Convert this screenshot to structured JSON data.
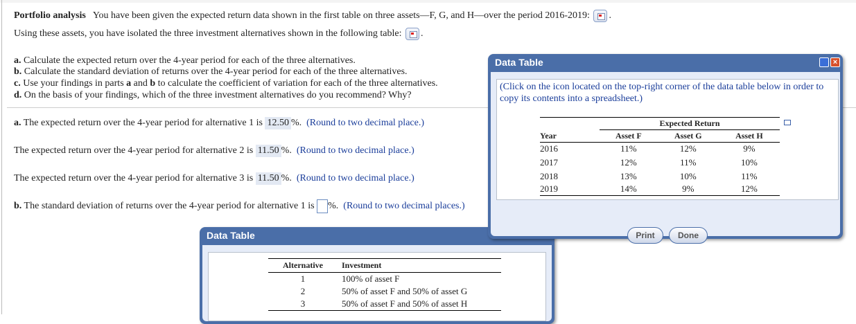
{
  "problem": {
    "title": "Portfolio analysis",
    "intro1": "You have been given the expected return data shown in the first table on three assets—F, G, and H—over the period 2016-2019:",
    "intro2": "Using these assets, you have isolated the three investment alternatives shown in the following table:",
    "parts": [
      {
        "letter": "a.",
        "text": "Calculate the expected return over the 4-year period for each of the three alternatives."
      },
      {
        "letter": "b.",
        "text": "Calculate the standard deviation of returns over the 4-year period for each of the three alternatives."
      },
      {
        "letter": "c.",
        "pre": "Use your findings in parts",
        "a": "a",
        "and": "and",
        "b": "b",
        "post": "to calculate the coefficient of variation for each of the three alternatives."
      },
      {
        "letter": "d.",
        "text": "On the basis of your findings, which of the three investment alternatives do you recommend?  Why?"
      }
    ]
  },
  "answers": [
    {
      "letter": "a.",
      "pre": "The expected return over the 4-year period for alternative 1 is",
      "value": "12.50",
      "unit": "%.",
      "hint": "(Round to two decimal place.)"
    },
    {
      "pre": "The expected return over the 4-year period for alternative 2 is",
      "value": "11.50",
      "unit": "%.",
      "hint": "(Round to two decimal place.)"
    },
    {
      "pre": "The expected return over the 4-year period for alternative 3 is",
      "value": "11.50",
      "unit": "%.",
      "hint": "(Round to two decimal place.)"
    },
    {
      "letter": "b.",
      "pre": "The standard deviation of returns over the 4-year period for alternative 1 is",
      "value": "",
      "unit": "%.",
      "hint": "(Round to two decimal places.)"
    }
  ],
  "dialog1": {
    "title": "Data Table",
    "note": "(Click on the icon located on the top-right corner of the data table below in order to copy its contents into a spreadsheet.)",
    "group_header": "Expected Return",
    "headers": [
      "Year",
      "Asset F",
      "Asset G",
      "Asset H"
    ],
    "rows": [
      [
        "2016",
        "11%",
        "12%",
        "9%"
      ],
      [
        "2017",
        "12%",
        "11%",
        "10%"
      ],
      [
        "2018",
        "13%",
        "10%",
        "11%"
      ],
      [
        "2019",
        "14%",
        "9%",
        "12%"
      ]
    ],
    "print": "Print",
    "done": "Done"
  },
  "dialog2": {
    "title": "Data Table",
    "headers": [
      "Alternative",
      "Investment"
    ],
    "rows": [
      [
        "1",
        "100% of asset F"
      ],
      [
        "2",
        "50% of asset F and 50% of asset G"
      ],
      [
        "3",
        "50% of asset F and 50% of asset H"
      ]
    ]
  }
}
